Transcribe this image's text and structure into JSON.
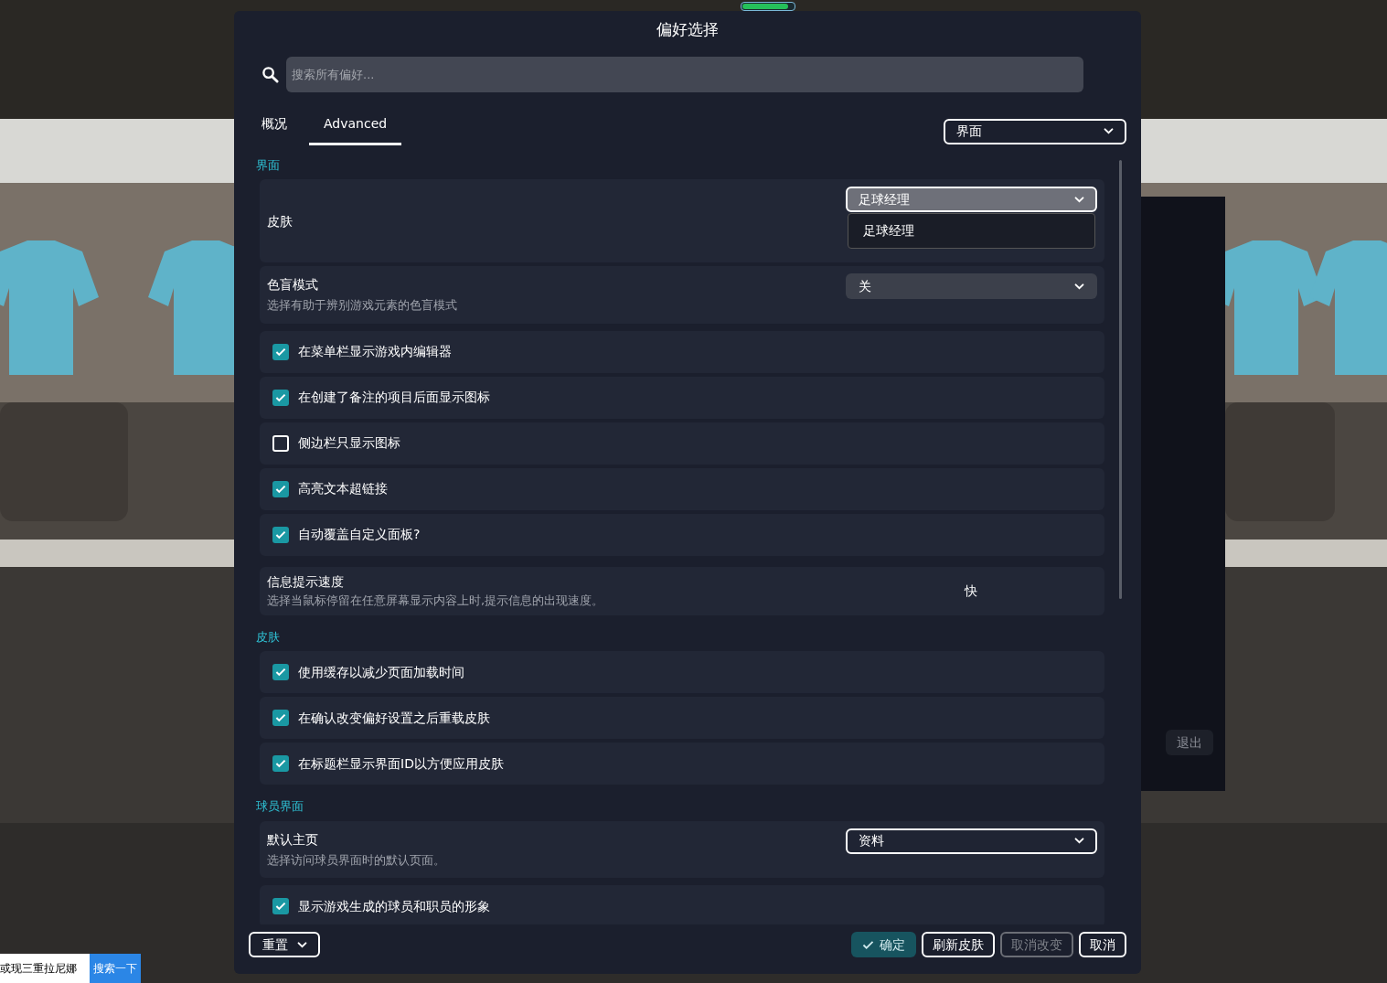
{
  "progress": {
    "level": 0.9
  },
  "window": {
    "title": "偏好选择"
  },
  "search": {
    "placeholder": "搜索所有偏好..."
  },
  "tabs": [
    {
      "label": "概况",
      "selected": false
    },
    {
      "label": "Advanced",
      "selected": true
    }
  ],
  "section_select": {
    "value": "界面"
  },
  "sections": [
    {
      "title": "界面",
      "rows": [
        {
          "kind": "dropdown",
          "label": "皮肤",
          "value": "足球经理",
          "open": true,
          "outlined": true,
          "options": [
            "足球经理"
          ]
        },
        {
          "kind": "dropdown",
          "label": "色盲模式",
          "description": "选择有助于辨别游戏元素的色盲模式",
          "value": "关",
          "open": false,
          "outlined": false
        },
        {
          "kind": "checkbox",
          "label": "在菜单栏显示游戏内编辑器",
          "checked": true
        },
        {
          "kind": "checkbox",
          "label": "在创建了备注的项目后面显示图标",
          "checked": true
        },
        {
          "kind": "checkbox",
          "label": "侧边栏只显示图标",
          "checked": false
        },
        {
          "kind": "checkbox",
          "label": "高亮文本超链接",
          "checked": true
        },
        {
          "kind": "checkbox",
          "label": "自动覆盖自定义面板?",
          "checked": true
        },
        {
          "kind": "value",
          "label": "信息提示速度",
          "description": "选择当鼠标停留在任意屏幕显示内容上时,提示信息的出现速度。",
          "value": "快"
        }
      ]
    },
    {
      "title": "皮肤",
      "rows": [
        {
          "kind": "checkbox",
          "label": "使用缓存以减少页面加载时间",
          "checked": true
        },
        {
          "kind": "checkbox",
          "label": "在确认改变偏好设置之后重载皮肤",
          "checked": true
        },
        {
          "kind": "checkbox",
          "label": "在标题栏显示界面ID以方便应用皮肤",
          "checked": true
        }
      ]
    },
    {
      "title": "球员界面",
      "rows": [
        {
          "kind": "dropdown",
          "label": "默认主页",
          "description": "选择访问球员界面时的默认页面。",
          "value": "资料",
          "open": false,
          "outlined": true
        },
        {
          "kind": "checkbox",
          "label": "显示游戏生成的球员和职员的形象",
          "checked": true
        }
      ]
    }
  ],
  "footer": {
    "reset": "重置",
    "buttons": [
      {
        "label": "确定",
        "kind": "primary",
        "disabled": false
      },
      {
        "label": "刷新皮肤",
        "kind": "default",
        "disabled": false
      },
      {
        "label": "取消改变",
        "kind": "default",
        "disabled": true
      },
      {
        "label": "取消",
        "kind": "default",
        "disabled": false
      }
    ]
  },
  "background_panel": {
    "exit": "退出"
  },
  "web_search": {
    "query": "或现三重拉尼娜",
    "button": "搜索一下"
  }
}
